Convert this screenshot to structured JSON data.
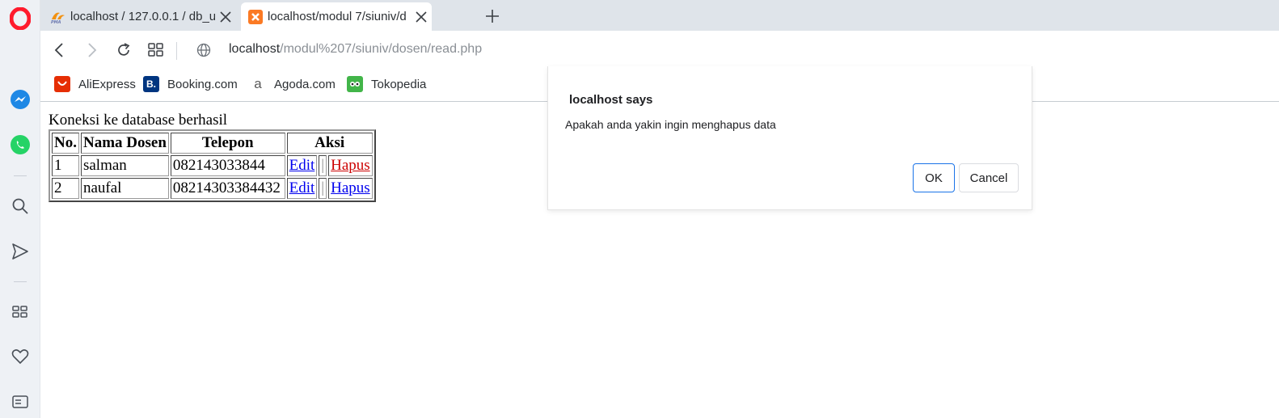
{
  "browser": {
    "tabs": [
      {
        "title": "localhost / 127.0.0.1 / db_u",
        "favicon": "phpmyadmin-icon",
        "active": false
      },
      {
        "title": "localhost/modul 7/siuniv/d",
        "favicon": "xampp-icon",
        "active": true
      }
    ],
    "address": {
      "host": "localhost",
      "path": "/modul%207/siuniv/dosen/read.php"
    },
    "bookmarks": [
      {
        "label": "AliExpress",
        "icon": "aliexpress-icon",
        "color": "#e62e04"
      },
      {
        "label": "Booking.com",
        "icon": "booking-icon",
        "color": "#003580",
        "icon_text": "B."
      },
      {
        "label": "Agoda.com",
        "icon": "agoda-icon",
        "color": "#5a5a5a",
        "icon_text": "a"
      },
      {
        "label": "Tokopedia",
        "icon": "tokopedia-icon",
        "color": "#42b549"
      }
    ]
  },
  "page": {
    "connection_message": "Koneksi ke database berhasil",
    "table": {
      "headers": [
        "No.",
        "Nama Dosen",
        "Telepon",
        "Aksi"
      ],
      "rows": [
        {
          "no": "1",
          "nama": "salman",
          "telepon": "082143033844",
          "edit": "Edit",
          "sep": "|",
          "hapus": "Hapus"
        },
        {
          "no": "2",
          "nama": "naufal",
          "telepon": "08214303384432",
          "edit": "Edit",
          "sep": "|",
          "hapus": "Hapus"
        }
      ]
    }
  },
  "dialog": {
    "title": "localhost says",
    "message": "Apakah anda yakin ingin menghapus data",
    "ok_label": "OK",
    "cancel_label": "Cancel"
  },
  "colors": {
    "link": "#0000ee",
    "visited_link": "#cc0000",
    "accent": "#1a73e8",
    "opera_red": "#ff1b2d"
  }
}
